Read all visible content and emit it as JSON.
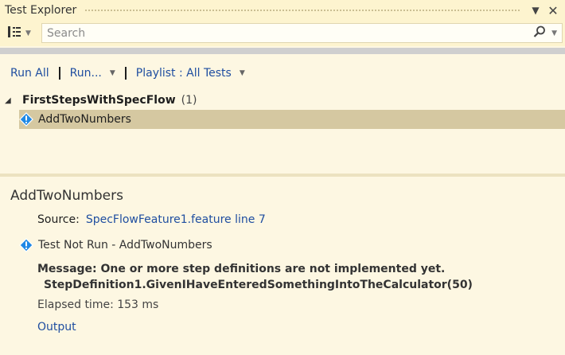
{
  "window": {
    "title": "Test Explorer"
  },
  "search": {
    "placeholder": "Search"
  },
  "toolbar": {
    "run_all": "Run All",
    "run": "Run...",
    "playlist": "Playlist : All Tests"
  },
  "tree": {
    "group_name": "FirstStepsWithSpecFlow",
    "group_count": "(1)",
    "items": [
      {
        "label": "AddTwoNumbers",
        "status_icon": "warning-info-icon"
      }
    ]
  },
  "details": {
    "title": "AddTwoNumbers",
    "source_label": "Source:",
    "source_link": "SpecFlowFeature1.feature line 7",
    "status_text": "Test Not Run - AddTwoNumbers",
    "message_line1": "Message: One or more step definitions are not implemented yet.",
    "message_line2": "StepDefinition1.GivenIHaveEnteredSomethingIntoTheCalculator(50)",
    "elapsed": "Elapsed time: 153 ms",
    "output_link": "Output"
  },
  "colors": {
    "background": "#fdf7e2",
    "link": "#1f4ea0",
    "selection": "#d5c8a1",
    "info_icon": "#1e88e5"
  }
}
